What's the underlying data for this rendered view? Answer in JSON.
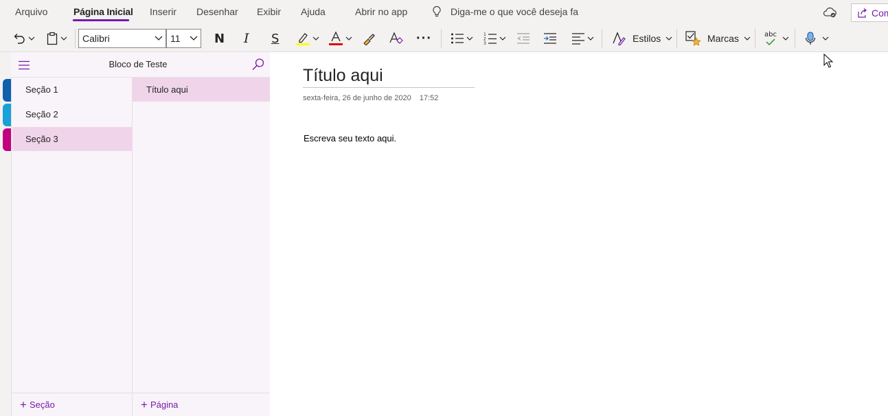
{
  "tabs": [
    {
      "label": "Arquivo"
    },
    {
      "label": "Página Inicial"
    },
    {
      "label": "Inserir"
    },
    {
      "label": "Desenhar"
    },
    {
      "label": "Exibir"
    },
    {
      "label": "Ajuda"
    },
    {
      "label": "Abrir no app"
    }
  ],
  "active_tab": "Página Inicial",
  "tell_me": {
    "placeholder": "Diga-me o que você deseja fa"
  },
  "share": {
    "label": "Com"
  },
  "ribbon": {
    "font_name": "Calibri",
    "font_size": "11",
    "bold_label": "N",
    "italic_label": "I",
    "underline_label": "S",
    "more_label": "···",
    "styles_label": "Estilos",
    "tags_label": "Marcas",
    "spell_label": "abc"
  },
  "icons": {
    "undo": "undo-icon",
    "clipboard": "clipboard-icon",
    "highlight": "highlighter-icon",
    "font_color": "font-color-icon",
    "format_painter": "format-painter-icon",
    "clear_format": "clear-formatting-icon",
    "bullets": "bullet-list-icon",
    "numbering": "numbered-list-icon",
    "outdent": "decrease-indent-icon",
    "indent": "increase-indent-icon",
    "align": "align-icon",
    "styles": "styles-icon",
    "tags": "tag-star-icon",
    "spelling": "spelling-icon",
    "dictate": "microphone-icon",
    "cloud": "cloud-sync-icon",
    "lightbulb": "lightbulb-icon",
    "share": "share-icon",
    "search": "search-icon",
    "menu": "hamburger-icon"
  },
  "colors": {
    "accent": "#7719aa",
    "highlight": "#ffff00",
    "font_color": "#e00000",
    "selection": "#f0d5ea",
    "panel_bg": "#f9f4f9",
    "section_1_tab": "#0f5fad",
    "section_2_tab": "#1aa1d8",
    "section_3_tab": "#c2007f"
  },
  "notebook": {
    "title": "Bloco de Teste"
  },
  "sections": [
    {
      "label": "Seção 1"
    },
    {
      "label": "Seção 2"
    },
    {
      "label": "Seção 3"
    }
  ],
  "selected_section": "Seção 3",
  "pages": [
    {
      "label": "Título aqui"
    }
  ],
  "footer": {
    "add_section": "Seção",
    "add_page": "Página"
  },
  "page": {
    "title": "Título aqui",
    "date": "sexta-feira, 26 de junho de 2020",
    "time": "17:52",
    "body": "Escreva seu texto aqui."
  }
}
